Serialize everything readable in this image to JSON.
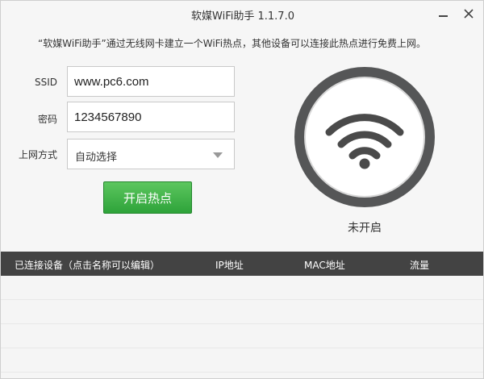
{
  "window": {
    "title": "软媒WiFi助手 1.1.7.0"
  },
  "description": "“软媒WiFi助手”通过无线网卡建立一个WiFi热点，其他设备可以连接此热点进行免费上网。",
  "form": {
    "ssid_label": "SSID",
    "ssid_value": "www.pc6.com",
    "password_label": "密码",
    "password_value": "1234567890",
    "mode_label": "上网方式",
    "mode_value": "自动选择",
    "start_button": "开启热点"
  },
  "hotspot": {
    "icon": "wifi-icon",
    "status": "未开启"
  },
  "table": {
    "columns": [
      "已连接设备（点击名称可以编辑）",
      "IP地址",
      "MAC地址",
      "流量"
    ],
    "rows": []
  },
  "colors": {
    "accent_green": "#2ea33a",
    "header_dark": "#434343",
    "ring": "#555657",
    "wifi_icon": "#4a4a4a"
  }
}
